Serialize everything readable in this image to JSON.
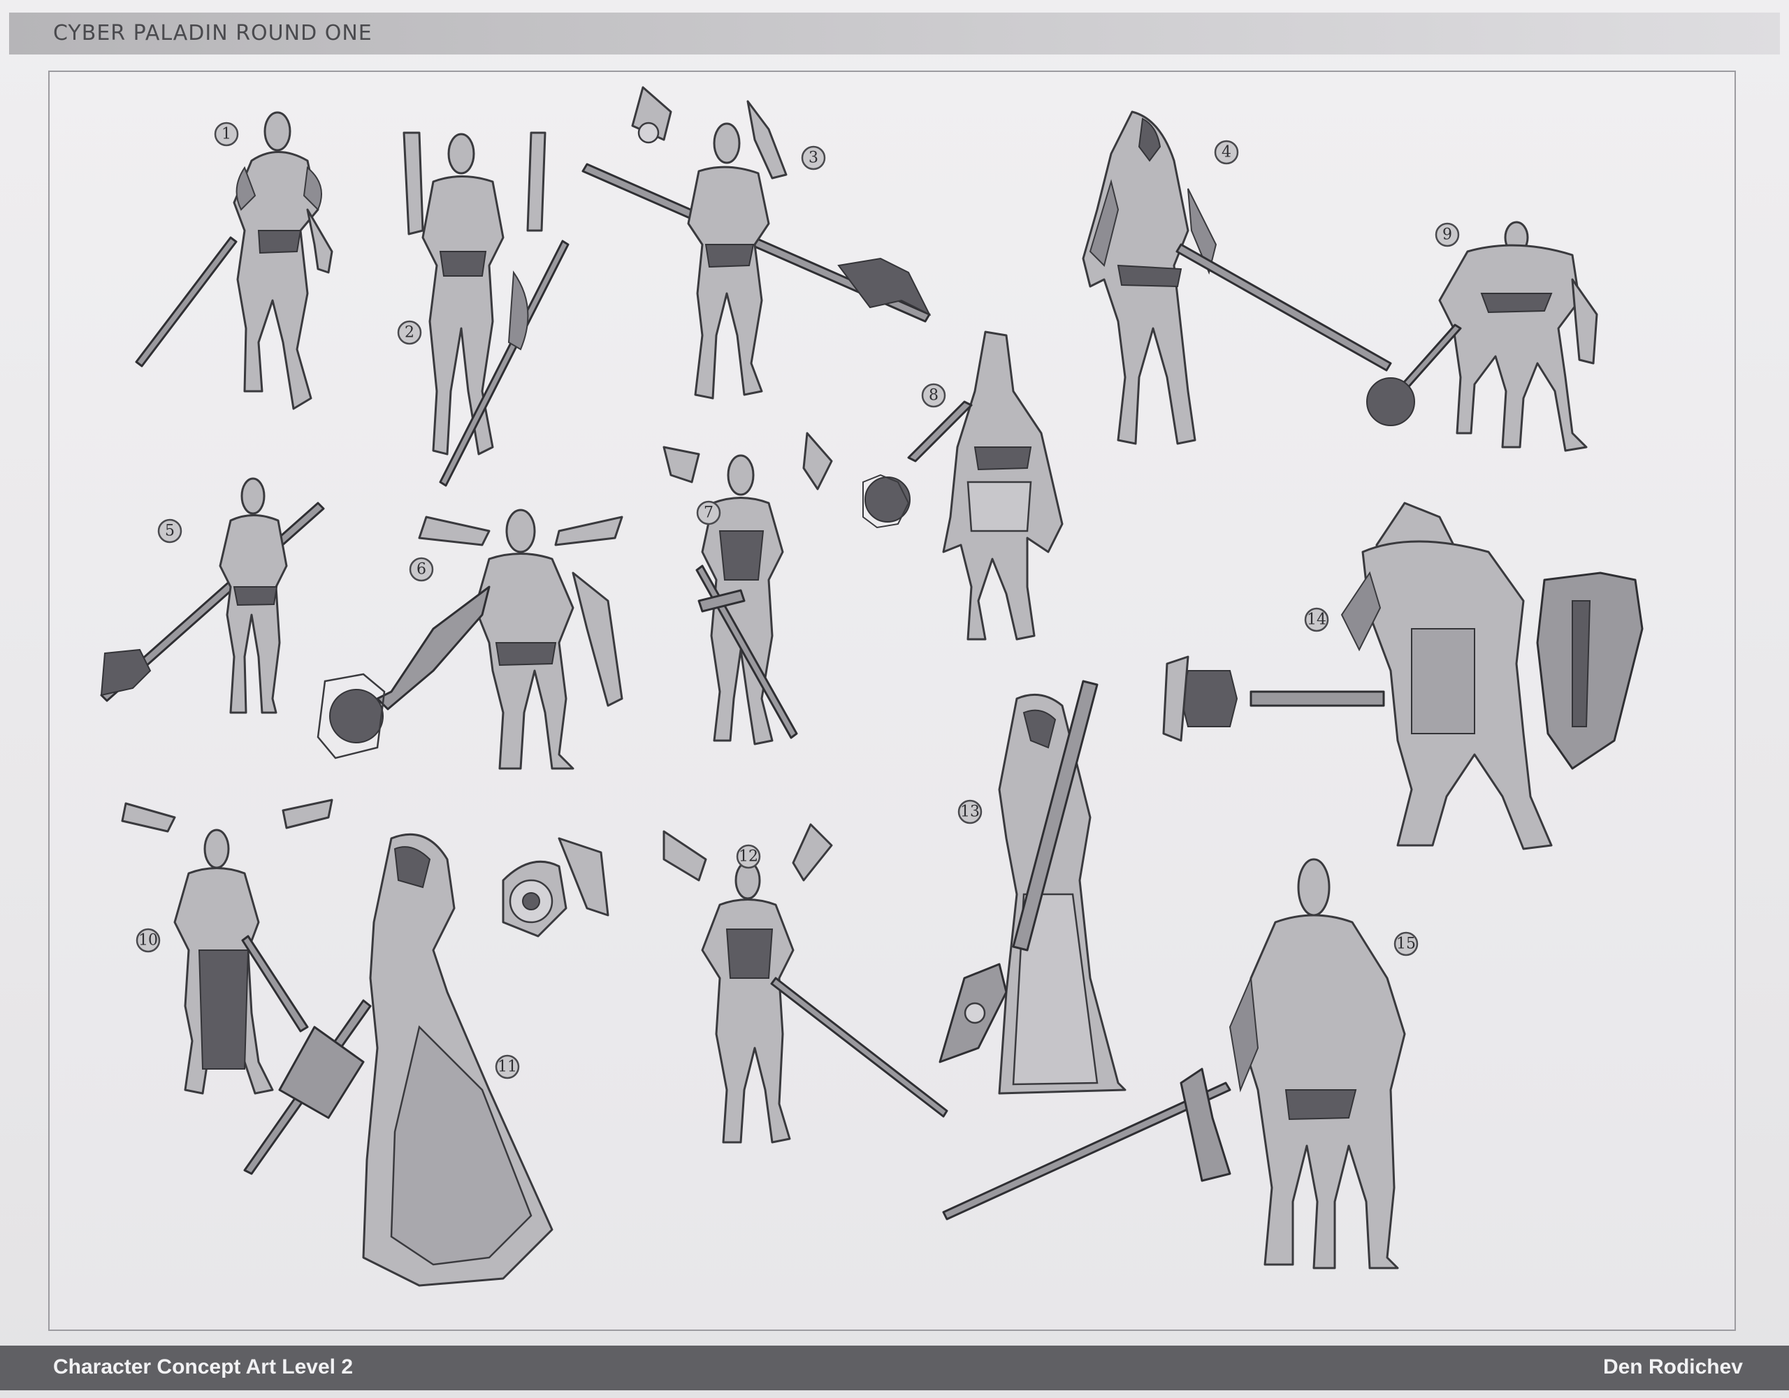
{
  "header": {
    "title": "CYBER PALADIN ROUND ONE"
  },
  "footer": {
    "course": "Character Concept Art Level 2",
    "artist": "Den Rodichev"
  },
  "colors": {
    "background": "#ecebed",
    "title_bar": "#c2c1c4",
    "footer_bar": "#606064",
    "figure_fill": "#b9b8bc",
    "outline": "#3a3a3e"
  },
  "figures": [
    {
      "label": "1"
    },
    {
      "label": "2"
    },
    {
      "label": "3"
    },
    {
      "label": "4"
    },
    {
      "label": "5"
    },
    {
      "label": "6"
    },
    {
      "label": "7"
    },
    {
      "label": "8"
    },
    {
      "label": "9"
    },
    {
      "label": "10"
    },
    {
      "label": "11"
    },
    {
      "label": "12"
    },
    {
      "label": "13"
    },
    {
      "label": "14"
    },
    {
      "label": "15"
    }
  ]
}
